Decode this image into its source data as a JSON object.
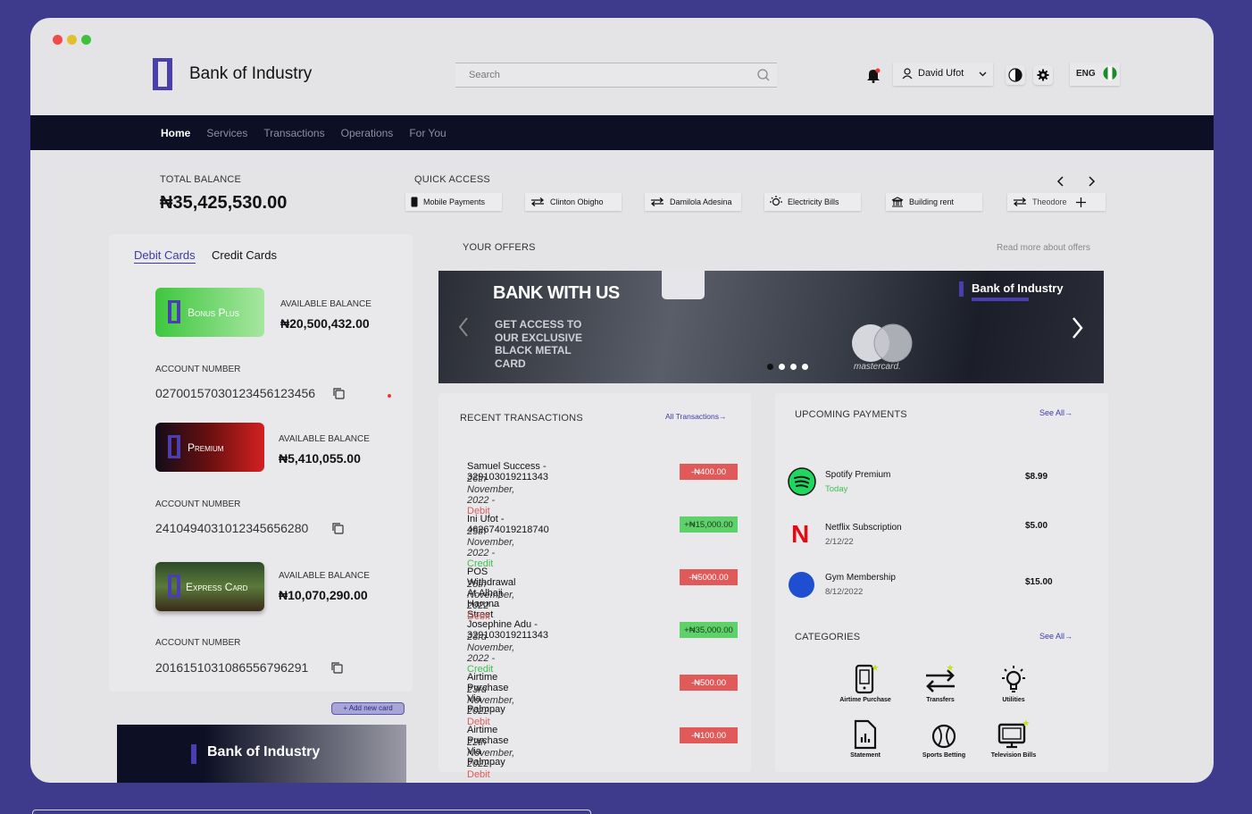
{
  "app": {
    "brand": "Bank of Industry"
  },
  "header": {
    "search_placeholder": "Search",
    "user_name": "David Ufot",
    "language": "ENG"
  },
  "nav": {
    "items": [
      "Home",
      "Services",
      "Transactions",
      "Operations",
      "For You"
    ],
    "active": "Home"
  },
  "balance": {
    "label": "TOTAL BALANCE",
    "value": "₦35,425,530.00"
  },
  "quick_access": {
    "label": "QUICK ACCESS",
    "items": [
      "Mobile Payments",
      "Clinton Obigho",
      "Damilola Adesina",
      "Electricity Bills",
      "Building rent",
      "Theodore"
    ]
  },
  "cards_tabs": {
    "debit": "Debit Cards",
    "credit": "Credit Cards"
  },
  "cards": [
    {
      "name": "Bonus Plus",
      "available_label": "AVAILABLE BALANCE",
      "available": "₦20,500,432.00",
      "account_label": "ACCOUNT NUMBER",
      "account": "0270015703012345612345​6"
    },
    {
      "name": "Premium",
      "available_label": "AVAILABLE BALANCE",
      "available": "₦5,410,055.00",
      "account_label": "ACCOUNT NUMBER",
      "account": "24104940310123456562​80"
    },
    {
      "name": "Express Card",
      "available_label": "AVAILABLE BALANCE",
      "available": "₦10,070,290.00",
      "account_label": "ACCOUNT NUMBER",
      "account": "20161510310865567962​91"
    }
  ],
  "add_card": "+ Add new card",
  "promo_brand": "Bank of Industry",
  "offers": {
    "label": "YOUR OFFERS",
    "read_more": "Read more about offers",
    "headline": "BANK WITH US",
    "body": "GET ACCESS TO OUR EXCLUSIVE BLACK METAL CARD",
    "brand": "Bank of Industry",
    "card_network": "mastercard."
  },
  "recent": {
    "label": "RECENT TRANSACTIONS",
    "link": "All Transactions→",
    "items": [
      {
        "title": "Samuel Success - 329103019211343",
        "date": "26th November, 2022 - ",
        "type": "Debit",
        "amount": "-₦400.00"
      },
      {
        "title": "Ini Ufot - 462674019218740",
        "date": "25th November, 2022 - ",
        "type": "Credit",
        "amount": "+₦15,000.00"
      },
      {
        "title": "POS Withdrawal At Alhaji Haruna Street",
        "date": "25th November, 2022 - ",
        "type": "Debit",
        "amount": "-₦5000.00"
      },
      {
        "title": "Josephine Adu - 329103019211343",
        "date": "23rd November, 2022 - ",
        "type": "Credit",
        "amount": "+₦35,000.00"
      },
      {
        "title": "Airtime Purchase Via Palmpay",
        "date": "23rd November, 2022 - ",
        "type": "Debit",
        "amount": "-₦500.00"
      },
      {
        "title": "Airtime Purchase Via Palmpay",
        "date": "22th November, 2022 - ",
        "type": "Debit",
        "amount": "-₦100.00"
      }
    ]
  },
  "upcoming": {
    "label": "UPCOMING PAYMENTS",
    "link": "See All→",
    "items": [
      {
        "name": "Spotify Premium",
        "date": "Today",
        "amount": "$8.99"
      },
      {
        "name": "Netflix Subscription",
        "date": "2/12/22",
        "amount": "$5.00"
      },
      {
        "name": "Gym Membership",
        "date": "8/12/2022",
        "amount": "$15.00"
      }
    ]
  },
  "categories": {
    "label": "CATEGORIES",
    "link": "See All→",
    "items": [
      "Airtime Purchase",
      "Transfers",
      "Utilities",
      "Statement",
      "Sports Betting",
      "Television Bills"
    ]
  },
  "colors": {
    "accent": "#4a3fb0",
    "nav_bg": "#0d1024",
    "debit": "#e05a5a",
    "credit": "#5fd16a"
  }
}
